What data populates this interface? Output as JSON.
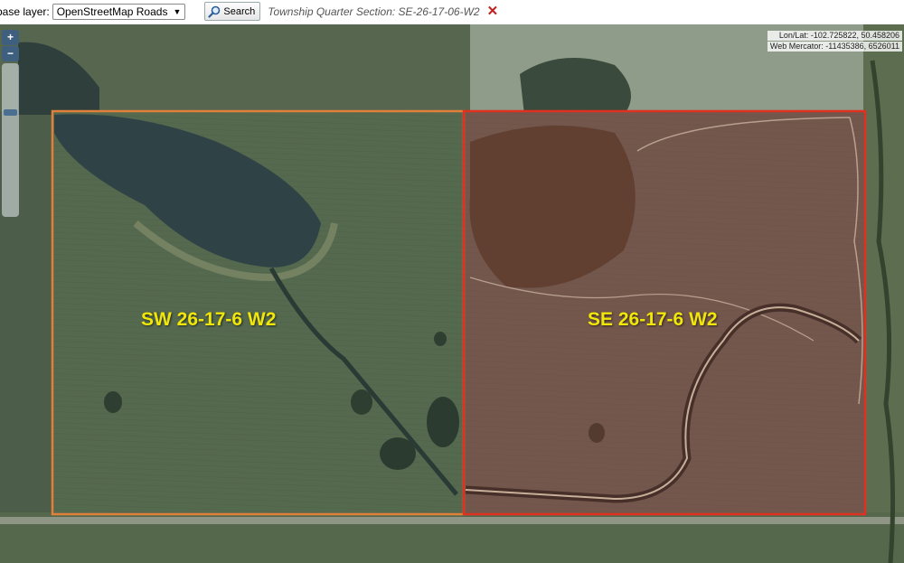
{
  "toolbar": {
    "base_layer_label": "base layer:",
    "base_layer_value": "OpenStreetMap Roads",
    "search_label": "Search",
    "quarter_text": "Township Quarter Section: SE-26-17-06-W2"
  },
  "zoom": {
    "plus": "+",
    "minus": "−"
  },
  "coords": {
    "lonlat": "Lon/Lat: -102.725822, 50.458206",
    "mercator": "Web Mercator: -11435386, 6526011"
  },
  "parcels": [
    {
      "label": "SW 26-17-6 W2",
      "outline_color": "#e0803a"
    },
    {
      "label": "SE 26-17-6 W2",
      "outline_color": "#e03020"
    }
  ],
  "colors": {
    "zoom_button": "#3f5f7f",
    "label_text": "#f0e60a"
  }
}
